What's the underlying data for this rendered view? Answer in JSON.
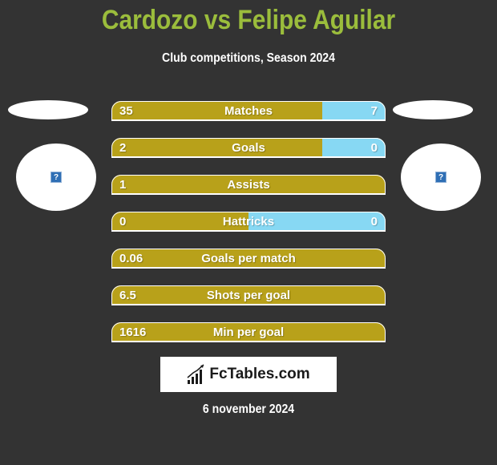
{
  "header": {
    "title": "Cardozo vs Felipe Aguilar",
    "subtitle": "Club competitions, Season 2024"
  },
  "players": {
    "left": {
      "avatar_icon": "question-mark-icon",
      "avatar_glyph": "?"
    },
    "right": {
      "avatar_icon": "question-mark-icon",
      "avatar_glyph": "?"
    }
  },
  "colors": {
    "title": "#9bbd3c",
    "left_bar": "#b8a11a",
    "right_bar": "#87d8f3",
    "background": "#333333"
  },
  "stats": [
    {
      "label": "Matches",
      "left": "35",
      "right": "7",
      "left_share": 0.77
    },
    {
      "label": "Goals",
      "left": "2",
      "right": "0",
      "left_share": 0.77
    },
    {
      "label": "Assists",
      "left": "1",
      "right": "",
      "left_share": 1.0
    },
    {
      "label": "Hattricks",
      "left": "0",
      "right": "0",
      "left_share": 0.5
    },
    {
      "label": "Goals per match",
      "left": "0.06",
      "right": "",
      "left_share": 1.0
    },
    {
      "label": "Shots per goal",
      "left": "6.5",
      "right": "",
      "left_share": 1.0
    },
    {
      "label": "Min per goal",
      "left": "1616",
      "right": "",
      "left_share": 1.0
    }
  ],
  "footer": {
    "logo_text": "FcTables.com",
    "logo_icon": "bar-chart-icon",
    "date": "6 november 2024"
  }
}
